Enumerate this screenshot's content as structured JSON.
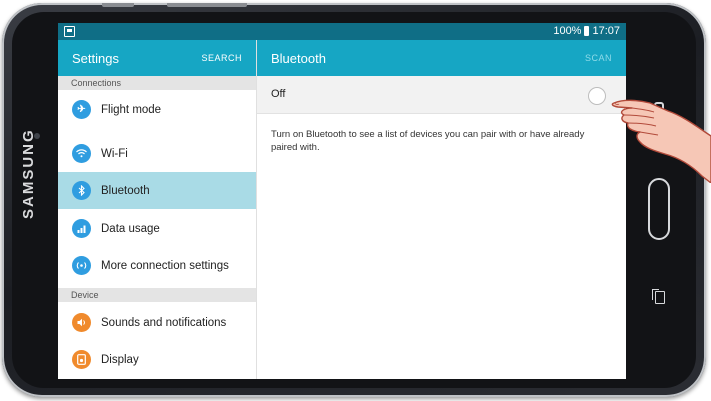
{
  "device": {
    "brand": "SAMSUNG"
  },
  "status_bar": {
    "battery": "100%",
    "time": "17:07"
  },
  "left_panel": {
    "title": "Settings",
    "search_label": "SEARCH",
    "sections": [
      {
        "header": "Connections",
        "items": [
          {
            "label": "Flight mode",
            "icon": "airplane-icon"
          },
          {
            "label": "Wi-Fi",
            "icon": "wifi-icon"
          },
          {
            "label": "Bluetooth",
            "icon": "bluetooth-icon",
            "selected": true
          },
          {
            "label": "Data usage",
            "icon": "data-usage-icon"
          },
          {
            "label": "More connection settings",
            "icon": "more-connections-icon"
          }
        ]
      },
      {
        "header": "Device",
        "items": [
          {
            "label": "Sounds and notifications",
            "icon": "sound-icon"
          },
          {
            "label": "Display",
            "icon": "display-icon"
          }
        ]
      }
    ]
  },
  "right_panel": {
    "title": "Bluetooth",
    "scan_label": "SCAN",
    "toggle_label": "Off",
    "toggle_state": false,
    "description": "Turn on Bluetooth to see a list of devices you can pair with or have already paired with."
  },
  "colors": {
    "accent": "#16a6c4",
    "status_bar": "#0f6e86",
    "selected_row": "#a9dbe6",
    "icon_blue": "#2f9de0",
    "icon_orange": "#f08a2c"
  }
}
